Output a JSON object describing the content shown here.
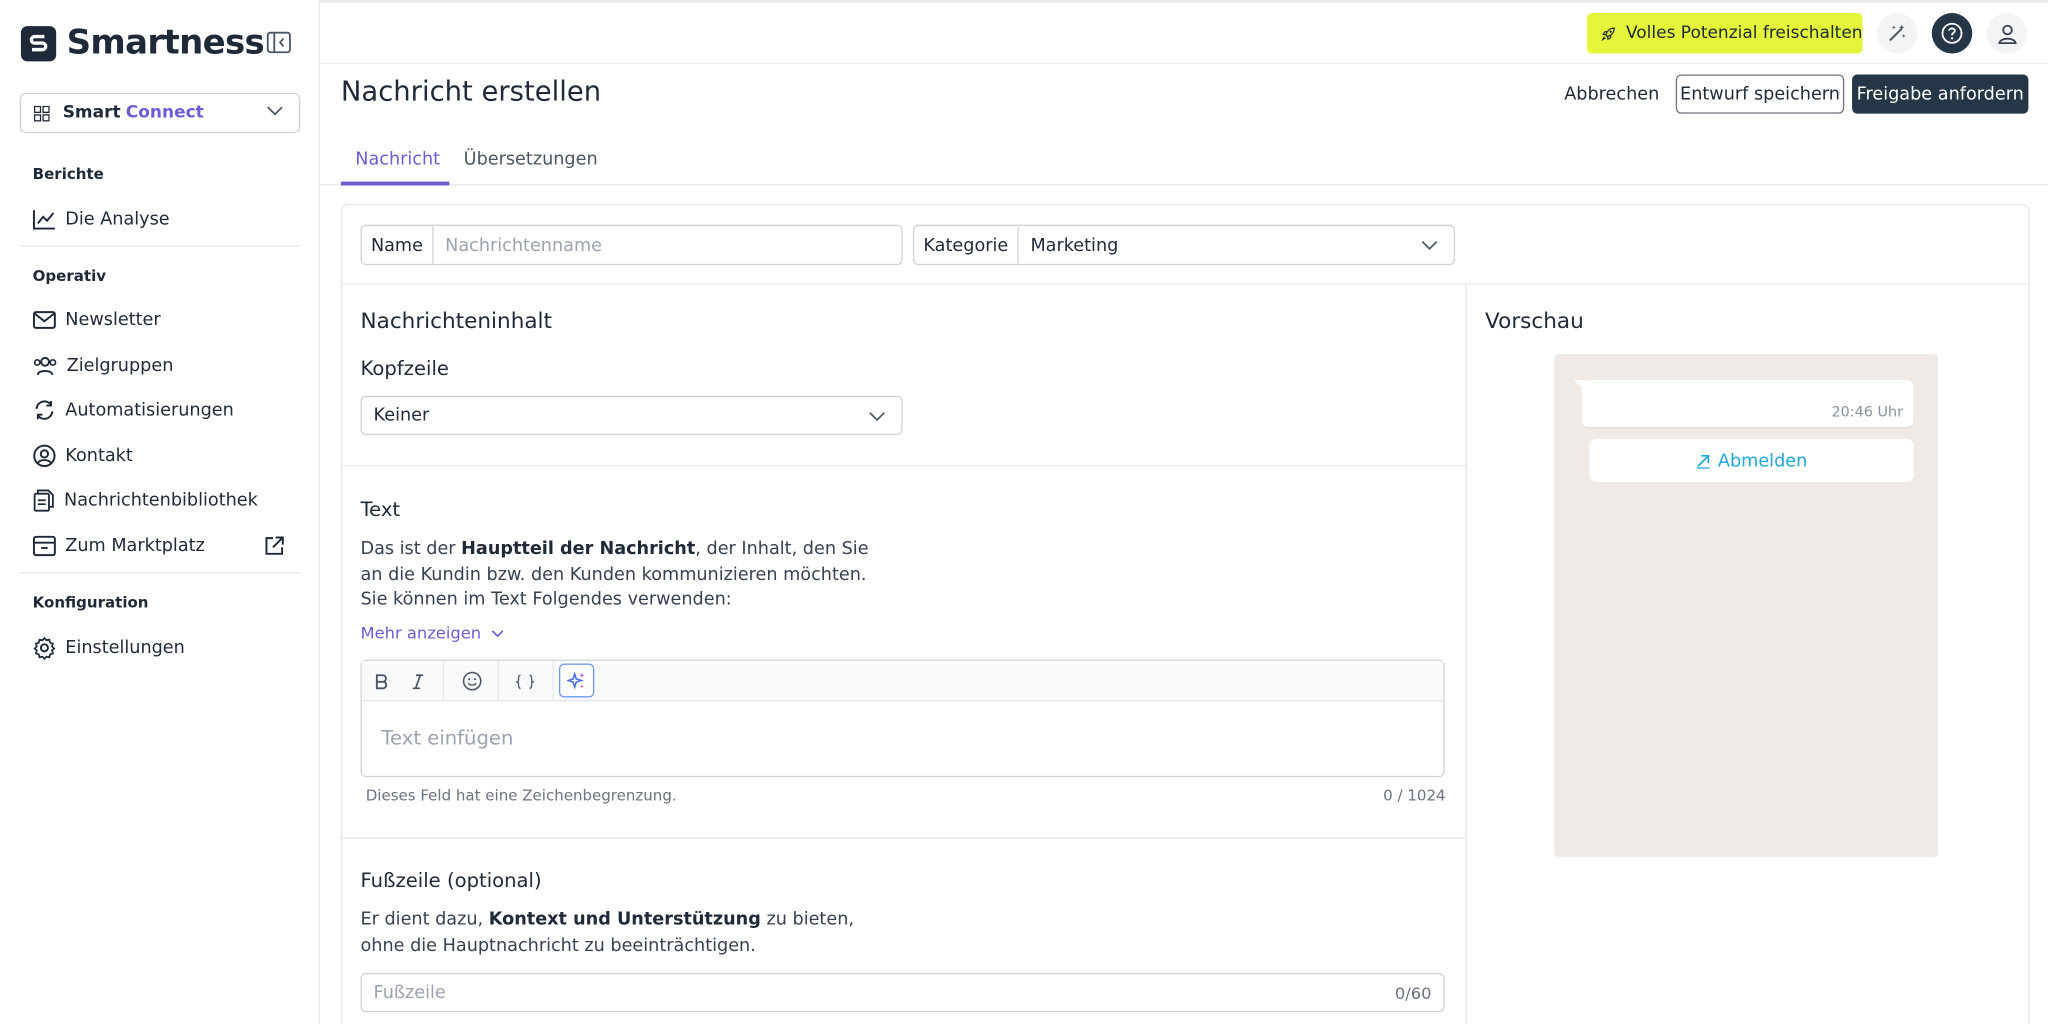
{
  "brand": {
    "name": "Smartness"
  },
  "workspace": {
    "prefix": "Smart",
    "product": "Connect"
  },
  "sidebar": {
    "sections": [
      {
        "title": "Berichte",
        "items": [
          {
            "label": "Die Analyse",
            "icon": "line-chart-icon"
          }
        ]
      },
      {
        "title": "Operativ",
        "items": [
          {
            "label": "Newsletter",
            "icon": "mail-icon"
          },
          {
            "label": "Zielgruppen",
            "icon": "users-icon"
          },
          {
            "label": "Automatisierungen",
            "icon": "refresh-icon"
          },
          {
            "label": "Kontakt",
            "icon": "user-circle-icon"
          },
          {
            "label": "Nachrichtenbibliothek",
            "icon": "documents-icon"
          },
          {
            "label": "Zum Marktplatz",
            "icon": "store-icon"
          }
        ]
      },
      {
        "title": "Konfiguration",
        "items": [
          {
            "label": "Einstellungen",
            "icon": "gear-icon"
          }
        ]
      }
    ]
  },
  "topbar": {
    "unlock_label": "Volles Potenzial freischalten"
  },
  "header": {
    "title": "Nachricht erstellen",
    "cancel_label": "Abbrechen",
    "draft_label": "Entwurf speichern",
    "approve_label": "Freigabe anfordern"
  },
  "tabs": [
    {
      "label": "Nachricht",
      "active": true
    },
    {
      "label": "Übersetzungen",
      "active": false
    }
  ],
  "form": {
    "name_label": "Name",
    "name_placeholder": "Nachrichtenname",
    "category_label": "Kategorie",
    "category_value": "Marketing"
  },
  "content": {
    "section_title": "Nachrichteninhalt",
    "header_title": "Kopfzeile",
    "header_value": "Keiner",
    "text_title": "Text",
    "text_desc_pre": "Das ist der ",
    "text_desc_bold": "Hauptteil der Nachricht",
    "text_desc_post": ", der Inhalt, den Sie an die Kundin bzw. den Kunden kommunizieren möchten. Sie können im Text Folgendes verwenden:",
    "more_label": "Mehr anzeigen",
    "editor_placeholder": "Text einfügen",
    "char_limit_note": "Dieses Feld hat eine Zeichenbegrenzung.",
    "char_count": "0 / 1024",
    "footer_title": "Fußzeile (optional)",
    "footer_desc_pre": "Er dient dazu, ",
    "footer_desc_bold": "Kontext und Unterstützung",
    "footer_desc_post": " zu bieten, ohne die Hauptnachricht zu beeinträchtigen.",
    "footer_placeholder": "Fußzeile",
    "footer_count": "0/60"
  },
  "preview": {
    "title": "Vorschau",
    "time": "20:46 Uhr",
    "unsubscribe_label": "Abmelden"
  },
  "colors": {
    "accent": "#6d5dd3",
    "primary_dark": "#253746",
    "highlight": "#e5f53a",
    "link_blue": "#1ea7d8"
  }
}
